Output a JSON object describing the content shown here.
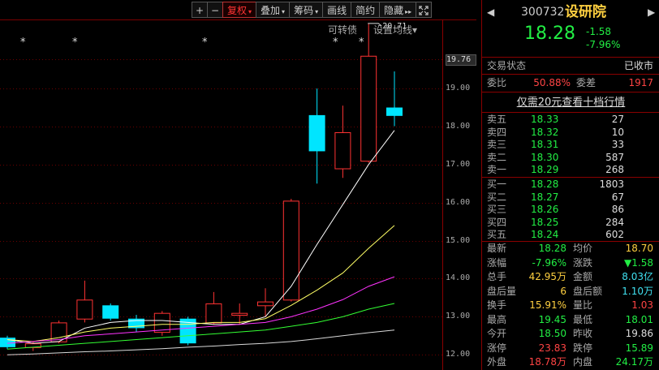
{
  "toolbar": {
    "plus": "+",
    "minus": "−",
    "fuquan": "复权",
    "diejia": "叠加",
    "chouma": "筹码",
    "huaxian": "画线",
    "jianyue": "简约",
    "yincang": "隐藏",
    "arrow_glyph": "▾",
    "hide_glyph": "▸▸"
  },
  "chart_links": {
    "convertible": "可转债",
    "ma_settings": "设置均线▾"
  },
  "peak_annotation": "20.71",
  "colors": {
    "up": "#ff3333",
    "down": "#00e5ff",
    "ma5": "#ffffff",
    "ma10": "#ffff66",
    "ma20": "#ff33ff",
    "ma60": "#33ff33",
    "ma120": "#ffffff"
  },
  "chart_data": {
    "type": "candlestick",
    "y_axis_ticks": [
      "19.76",
      "19.00",
      "18.00",
      "17.00",
      "16.00",
      "15.00",
      "14.00",
      "13.00",
      "12.00"
    ],
    "highlight_tick": "19.76",
    "ylim": [
      11.6,
      20.9
    ],
    "grid": true,
    "candles": [
      {
        "o": 12.45,
        "c": 12.2,
        "h": 12.5,
        "l": 12.15
      },
      {
        "o": 12.2,
        "c": 12.3,
        "h": 12.35,
        "l": 12.1
      },
      {
        "o": 12.35,
        "c": 12.85,
        "h": 12.9,
        "l": 12.3
      },
      {
        "o": 12.95,
        "c": 13.45,
        "h": 13.95,
        "l": 12.85
      },
      {
        "o": 13.3,
        "c": 12.95,
        "h": 13.35,
        "l": 12.9
      },
      {
        "o": 12.95,
        "c": 12.7,
        "h": 13.05,
        "l": 12.6
      },
      {
        "o": 12.6,
        "c": 13.1,
        "h": 13.15,
        "l": 12.5
      },
      {
        "o": 12.95,
        "c": 12.3,
        "h": 13.0,
        "l": 12.25
      },
      {
        "o": 12.85,
        "c": 13.35,
        "h": 13.65,
        "l": 12.8
      },
      {
        "o": 13.05,
        "c": 13.1,
        "h": 13.35,
        "l": 12.8
      },
      {
        "o": 13.3,
        "c": 13.4,
        "h": 13.75,
        "l": 13.0
      },
      {
        "o": 13.45,
        "c": 16.05,
        "h": 16.1,
        "l": 13.4
      },
      {
        "o": 18.3,
        "c": 17.35,
        "h": 19.0,
        "l": 16.5
      },
      {
        "o": 16.9,
        "c": 17.85,
        "h": 18.55,
        "l": 16.65
      },
      {
        "o": 17.1,
        "c": 19.86,
        "h": 20.71,
        "l": 17.05
      },
      {
        "o": 18.5,
        "c": 18.28,
        "h": 19.45,
        "l": 18.01
      }
    ],
    "ma_lines": [
      {
        "name": "MA5",
        "values": [
          12.4,
          12.3,
          12.35,
          12.7,
          12.85,
          12.9,
          12.9,
          12.85,
          12.8,
          12.8,
          13.0,
          13.8,
          14.9,
          15.95,
          17.0,
          17.9
        ]
      },
      {
        "name": "MA10",
        "values": [
          12.4,
          12.35,
          12.45,
          12.6,
          12.7,
          12.75,
          12.8,
          12.8,
          12.85,
          12.85,
          12.95,
          13.3,
          13.7,
          14.15,
          14.8,
          15.4
        ]
      },
      {
        "name": "MA20",
        "values": [
          12.3,
          12.35,
          12.4,
          12.5,
          12.55,
          12.6,
          12.65,
          12.7,
          12.75,
          12.8,
          12.85,
          13.0,
          13.2,
          13.45,
          13.8,
          14.05
        ]
      },
      {
        "name": "MA60",
        "values": [
          12.15,
          12.2,
          12.25,
          12.3,
          12.35,
          12.4,
          12.45,
          12.5,
          12.55,
          12.6,
          12.65,
          12.75,
          12.85,
          13.0,
          13.2,
          13.35
        ]
      },
      {
        "name": "MA120",
        "values": [
          12.0,
          12.02,
          12.05,
          12.08,
          12.1,
          12.13,
          12.16,
          12.2,
          12.23,
          12.27,
          12.3,
          12.35,
          12.42,
          12.5,
          12.58,
          12.65
        ]
      }
    ]
  },
  "stock": {
    "code": "300732",
    "name": "设研院",
    "price": "18.28",
    "change": "-1.58",
    "pct": "-7.96%"
  },
  "trade_status": {
    "label": "交易状态",
    "value": "已收市"
  },
  "ratio": {
    "wb_label": "委比",
    "wb_value": "50.88%",
    "wc_label": "委差",
    "wc_value": "1917"
  },
  "level2_link": "仅需20元查看十档行情",
  "asks": [
    {
      "label": "卖五",
      "price": "18.33",
      "vol": "27"
    },
    {
      "label": "卖四",
      "price": "18.32",
      "vol": "10"
    },
    {
      "label": "卖三",
      "price": "18.31",
      "vol": "33"
    },
    {
      "label": "卖二",
      "price": "18.30",
      "vol": "587"
    },
    {
      "label": "卖一",
      "price": "18.29",
      "vol": "268"
    }
  ],
  "bids": [
    {
      "label": "买一",
      "price": "18.28",
      "vol": "1803"
    },
    {
      "label": "买二",
      "price": "18.27",
      "vol": "67"
    },
    {
      "label": "买三",
      "price": "18.26",
      "vol": "86"
    },
    {
      "label": "买四",
      "price": "18.25",
      "vol": "284"
    },
    {
      "label": "买五",
      "price": "18.24",
      "vol": "602"
    }
  ],
  "stats": [
    {
      "l1": "最新",
      "v1": "18.28",
      "c1": "green",
      "l2": "均价",
      "v2": "18.70",
      "c2": "yellow"
    },
    {
      "l1": "涨幅",
      "v1": "-7.96%",
      "c1": "green",
      "l2": "涨跌",
      "v2": "▼1.58",
      "c2": "green"
    },
    {
      "l1": "总手",
      "v1": "42.95万",
      "c1": "yellow",
      "l2": "金额",
      "v2": "8.03亿",
      "c2": "cyan"
    },
    {
      "l1": "盘后量",
      "v1": "6",
      "c1": "yellow",
      "l2": "盘后额",
      "v2": "1.10万",
      "c2": "cyan"
    },
    {
      "l1": "换手",
      "v1": "15.91%",
      "c1": "yellow",
      "l2": "量比",
      "v2": "1.03",
      "c2": "red"
    },
    {
      "l1": "最高",
      "v1": "19.45",
      "c1": "green",
      "l2": "最低",
      "v2": "18.01",
      "c2": "green"
    },
    {
      "l1": "今开",
      "v1": "18.50",
      "c1": "green",
      "l2": "昨收",
      "v2": "19.86",
      "c2": "white"
    },
    {
      "l1": "涨停",
      "v1": "23.83",
      "c1": "red",
      "l2": "跌停",
      "v2": "15.89",
      "c2": "green"
    },
    {
      "l1": "外盘",
      "v1": "18.78万",
      "c1": "red",
      "l2": "内盘",
      "v2": "24.17万",
      "c2": "green"
    }
  ]
}
